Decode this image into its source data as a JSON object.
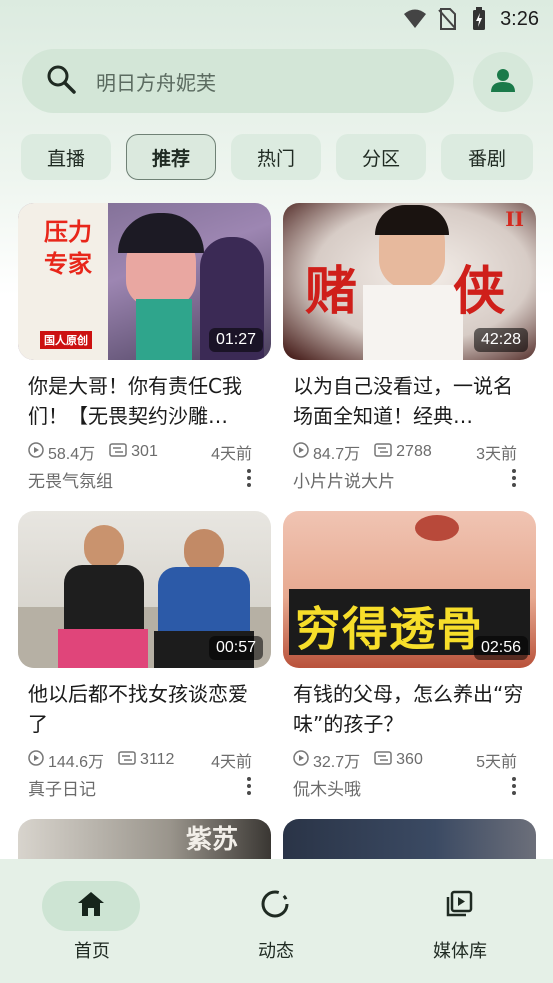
{
  "status_bar": {
    "time": "3:26"
  },
  "search": {
    "placeholder": "明日方舟妮芙"
  },
  "tabs": [
    {
      "label": "直播"
    },
    {
      "label": "推荐"
    },
    {
      "label": "热门"
    },
    {
      "label": "分区"
    },
    {
      "label": "番剧"
    }
  ],
  "active_tab": "推荐",
  "videos": [
    {
      "title": "你是大哥！你有责任C我们！【无畏契约沙雕…",
      "duration": "01:27",
      "views": "58.4万",
      "comments": "301",
      "age": "4天前",
      "author": "无畏气氛组",
      "thumb_text": [
        "压力",
        "专家"
      ],
      "thumb_tag": "国人原创"
    },
    {
      "title": "以为自己没看过，一说名场面全知道！经典…",
      "duration": "42:28",
      "views": "84.7万",
      "comments": "2788",
      "age": "3天前",
      "author": "小片片说大片",
      "thumb_text": [
        "赌",
        "侠"
      ],
      "thumb_tag": "II"
    },
    {
      "title": "他以后都不找女孩谈恋爱了",
      "duration": "00:57",
      "views": "144.6万",
      "comments": "3112",
      "age": "4天前",
      "author": "真子日记"
    },
    {
      "title": "有钱的父母，怎么养出“穷味”的孩子？",
      "duration": "02:56",
      "views": "32.7万",
      "comments": "360",
      "age": "5天前",
      "author": "侃木头哦",
      "thumb_text": [
        "穷得透骨"
      ]
    }
  ],
  "partial_thumbs": [
    {
      "thumb_text": "紫苏"
    },
    {
      "thumb_text": ""
    }
  ],
  "bottom_nav": [
    {
      "label": "首页",
      "icon": "home-icon"
    },
    {
      "label": "动态",
      "icon": "activity-icon"
    },
    {
      "label": "媒体库",
      "icon": "library-icon"
    }
  ],
  "colors": {
    "accent": "#1b7a4a",
    "search_bg": "#d3e6d7",
    "nav_bg": "#e5f0e7"
  }
}
